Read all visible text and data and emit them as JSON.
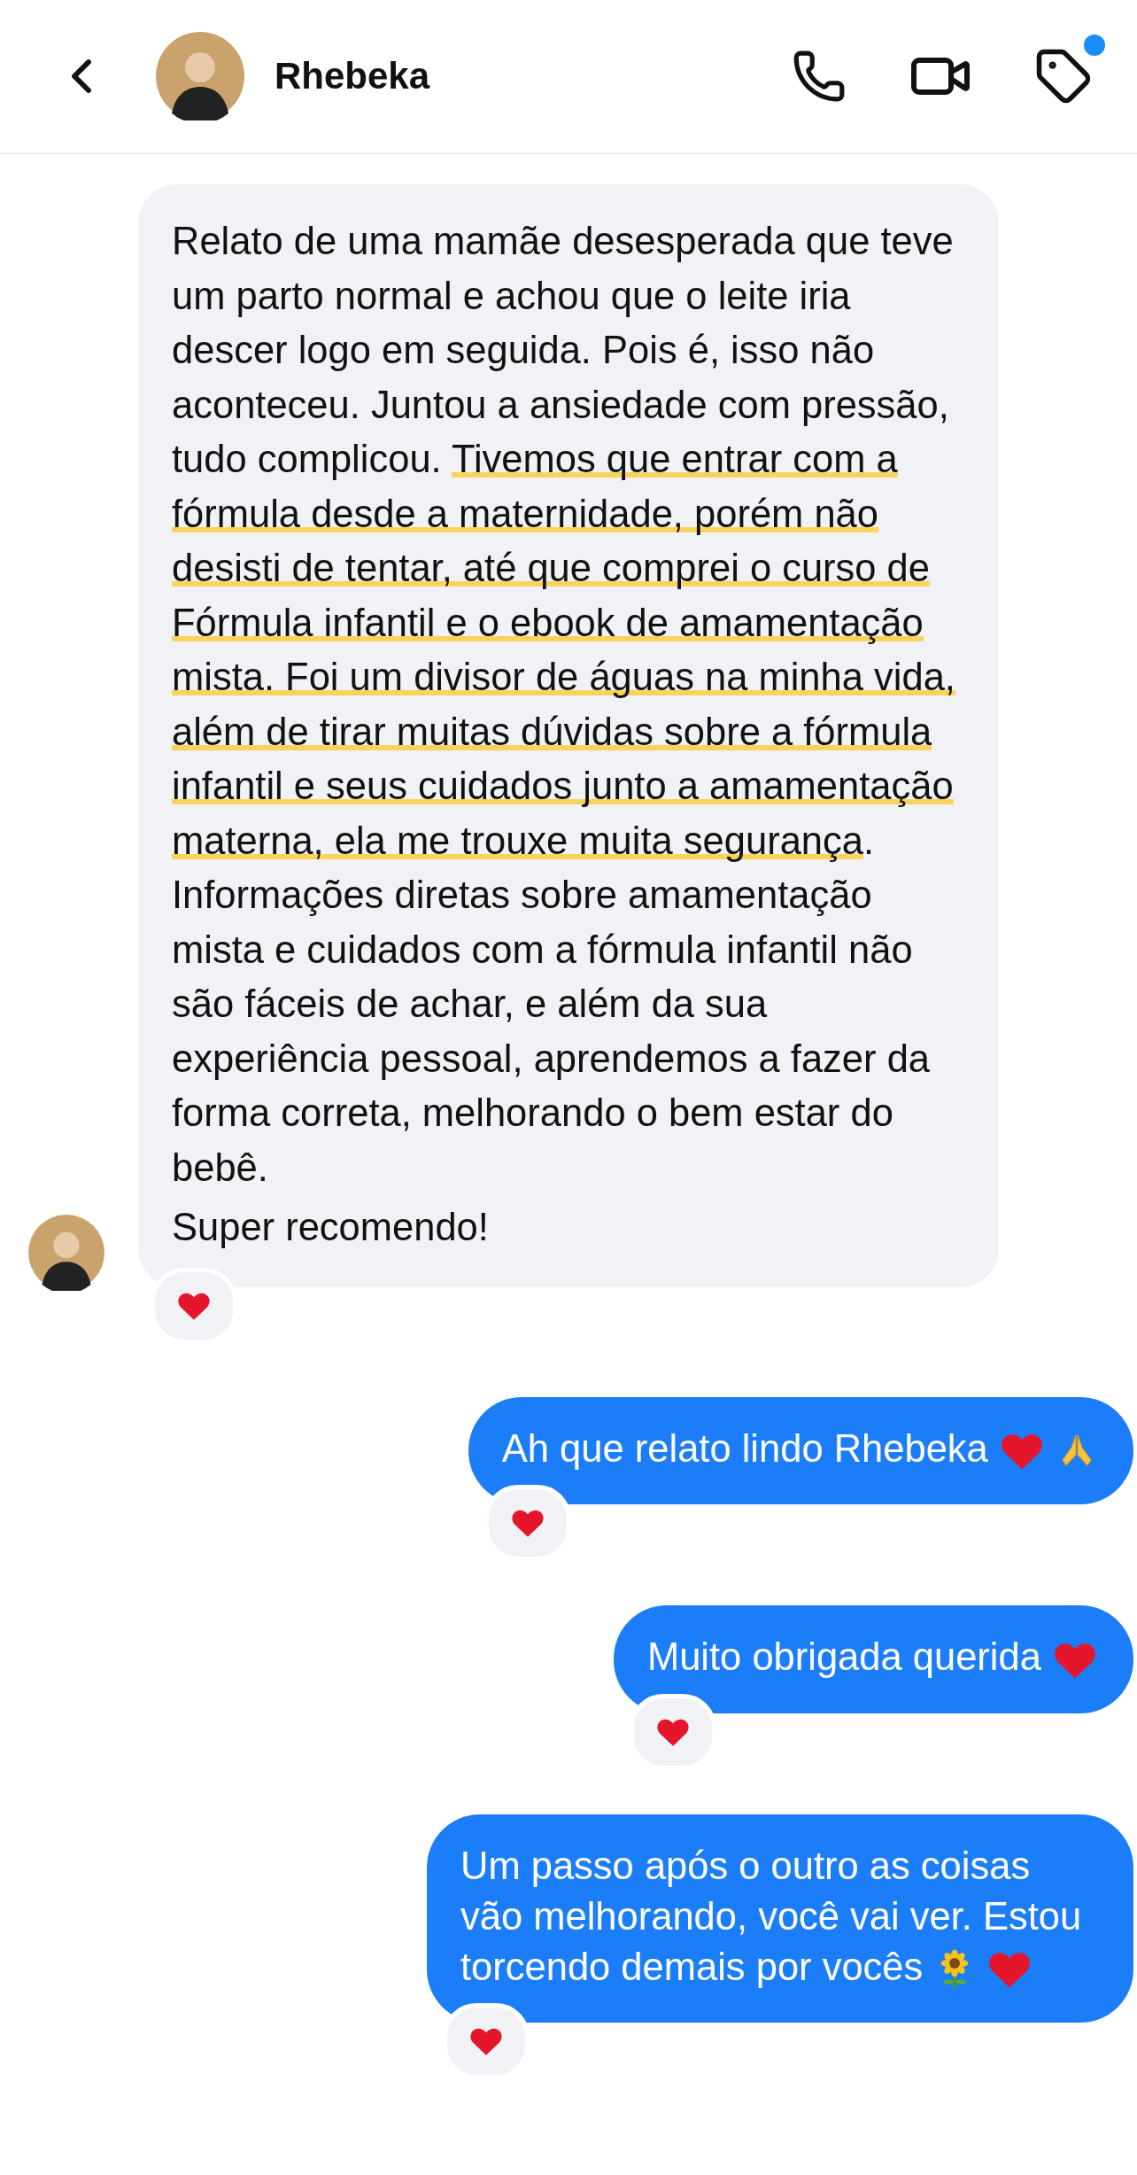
{
  "header": {
    "contact_name": "Rhebeka",
    "tag_badge": true
  },
  "incoming": {
    "paragraphs": [
      [
        {
          "text": "Relato de uma mamãe desesperada que teve um parto normal e achou que o leite iria descer logo em seguida. Pois é, isso não aconteceu. Juntou a ansiedade com pressão, tudo complicou. ",
          "highlighted": false
        },
        {
          "text": "Tivemos que entrar com a fórmula desde a maternidade, porém não desisti de tentar, até que comprei o curso de Fórmula infantil e o ebook de amamentação mista. Foi um divisor de águas na minha vida, além de tirar muitas dúvidas sobre a fórmula infantil e seus cuidados junto a amamentação materna, ela me trouxe muita segurança",
          "highlighted": true
        },
        {
          "text": ". Informações diretas sobre amamentação mista e cuidados com a fórmula infantil não são fáceis de achar, e além da sua experiência pessoal, aprendemos a fazer da forma correta, melhorando o bem estar do bebê.",
          "highlighted": false
        }
      ],
      [
        {
          "text": "Super recomendo!",
          "highlighted": false
        }
      ]
    ],
    "heart_reaction": true
  },
  "outgoing": [
    {
      "segments": [
        {
          "kind": "text",
          "text": "Ah que relato lindo Rhebeka"
        },
        {
          "kind": "heart"
        },
        {
          "kind": "pray"
        }
      ],
      "heart_reaction": true
    },
    {
      "segments": [
        {
          "kind": "text",
          "text": "Muito obrigada querida"
        },
        {
          "kind": "heart"
        }
      ],
      "heart_reaction": true
    },
    {
      "segments": [
        {
          "kind": "text",
          "text": "Um passo após o outro as coisas vão melhorando, você vai ver. Estou torcendo demais por vocês"
        },
        {
          "kind": "sunflower"
        },
        {
          "kind": "heart"
        }
      ],
      "heart_reaction": true
    }
  ]
}
